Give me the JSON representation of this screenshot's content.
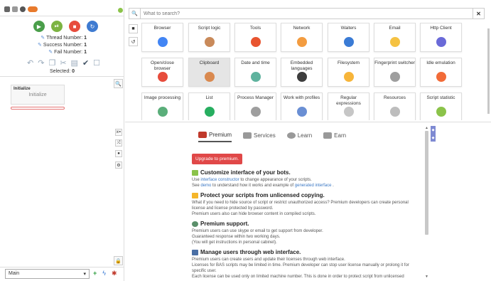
{
  "controls": {
    "thread_label": "Thread Number:",
    "thread_value": "1",
    "success_label": "Success Number:",
    "success_value": "1",
    "fail_label": "Fail Number:",
    "fail_value": "1",
    "selected_label": "Selected:",
    "selected_value": "0"
  },
  "initialize": {
    "header": "Initialize",
    "body": "Initialize"
  },
  "bottom": {
    "function_select": "Main"
  },
  "search": {
    "placeholder": "What to search?"
  },
  "tiles": [
    {
      "label": "Browser",
      "icon": "chrome-icon",
      "color": "#4285f4"
    },
    {
      "label": "Script logic",
      "icon": "logic-icon",
      "color": "#c98a5a"
    },
    {
      "label": "Tools",
      "icon": "wrench-icon",
      "color": "#e8542f"
    },
    {
      "label": "Network",
      "icon": "network-icon",
      "color": "#f39c40"
    },
    {
      "label": "Waiters",
      "icon": "hourglass-icon",
      "color": "#3a7bd5"
    },
    {
      "label": "Email",
      "icon": "email-icon",
      "color": "#f5c242"
    },
    {
      "label": "Http Client",
      "icon": "http-client-icon",
      "color": "#6a6ad8"
    },
    {
      "label": "Open/close browser",
      "icon": "power-icon",
      "color": "#e74c3c"
    },
    {
      "label": "Clipboard",
      "icon": "clipboard-icon",
      "color": "#d9894f"
    },
    {
      "label": "Date and time",
      "icon": "calendar-icon",
      "color": "#5fb39e"
    },
    {
      "label": "Embedded languages",
      "icon": "code-icon",
      "color": "#3d3d3d"
    },
    {
      "label": "Filesystem",
      "icon": "folder-icon",
      "color": "#f7b53a"
    },
    {
      "label": "Fingerprint switcher",
      "icon": "fingerprint-icon",
      "color": "#9e9e9e"
    },
    {
      "label": "Idle emulation",
      "icon": "stopwatch-icon",
      "color": "#f26b38"
    },
    {
      "label": "Image processing",
      "icon": "image-icon",
      "color": "#5aae7a"
    },
    {
      "label": "List",
      "icon": "list-icon",
      "color": "#27ae60"
    },
    {
      "label": "Process Manager",
      "icon": "process-icon",
      "color": "#9e9e9e"
    },
    {
      "label": "Work with profiles",
      "icon": "profile-icon",
      "color": "#6a8fd4"
    },
    {
      "label": "Regular expressions",
      "icon": "regex-icon",
      "color": "#c6c6c6"
    },
    {
      "label": "Resources",
      "icon": "resources-icon",
      "color": "#bdbdbd"
    },
    {
      "label": "Script statistic",
      "icon": "pie-chart-icon",
      "color": "#8bc34a"
    }
  ],
  "premium": {
    "tabs": [
      "Premium",
      "Services",
      "Learn",
      "Earn"
    ],
    "upgrade_label": "Upgrade to premium.",
    "s1_title": "Customize interface of your bots.",
    "s1_l1_a": "Use ",
    "s1_l1_link": "interface constructor",
    "s1_l1_b": " to change appearance of your scripts.",
    "s1_l2_a": "See ",
    "s1_l2_link": "demo",
    "s1_l2_b": " to understand how it works and example of ",
    "s1_l2_link2": "generated interface",
    "s1_l2_c": " .",
    "s2_title": "Protect your scripts from unlicensed copying.",
    "s2_text": "What if you need to hide source of script or restrict unauthorized access? Premium developers can create personal license and license protected by password.",
    "s2_text2": "Premium users also can hide browser content in compiled scripts.",
    "s3_title": "Premium support.",
    "s3_l1": "Premium users can use skype or email to get support from developer.",
    "s3_l2": "Guaranteed response within two working days.",
    "s3_l3": "(You will get instructions in personal cabinet).",
    "s4_title": "Manage users through web interface.",
    "s4_l1": "Premium users can create users and update their licenses through web interface.",
    "s4_l2": "Licenses for BAS scripts may be limited in time. Premium developer can stop user license manually or prolong it for specific user.",
    "s4_l3": "Each license can be used only on limited machine number. This is done in order to protect script from unlicensed"
  },
  "colors": {
    "play": "#4a9e4a",
    "pause": "#7cb342",
    "stop": "#e74c3c",
    "restart": "#3f7bd1",
    "upgrade": "#e04848",
    "link": "#3b78c4"
  }
}
